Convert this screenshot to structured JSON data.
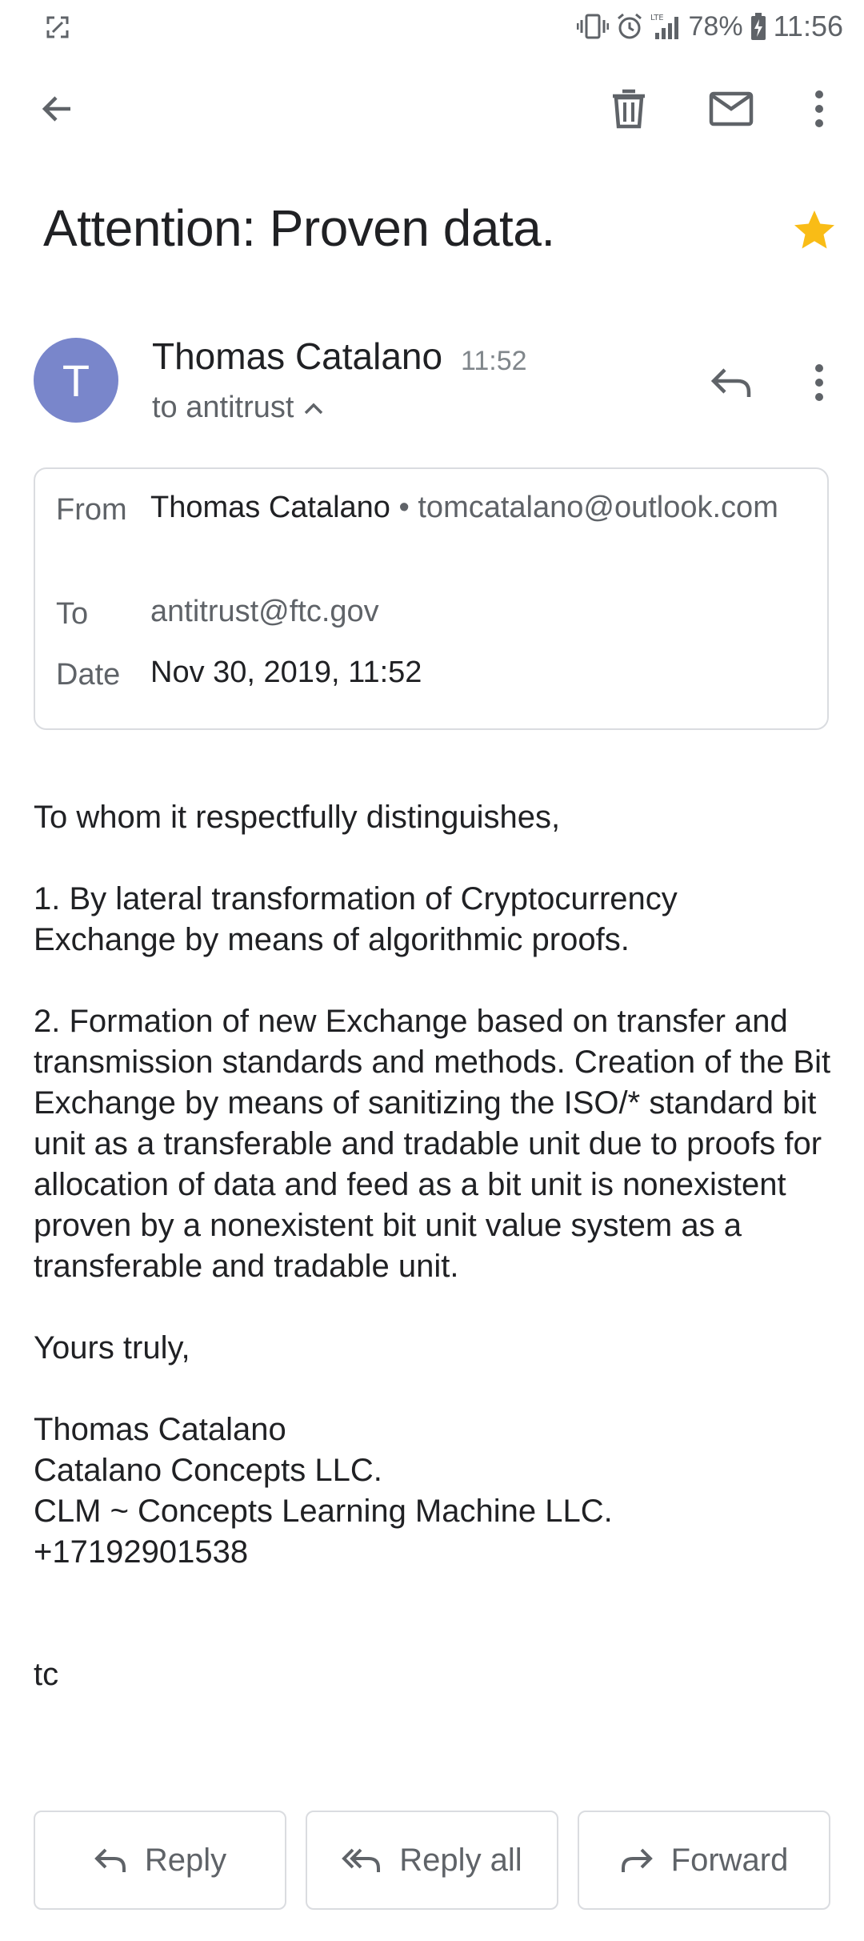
{
  "status_bar": {
    "battery": "78%",
    "time": "11:56",
    "network_label": "LTE"
  },
  "toolbar": {
    "back_icon": "arrow-back-icon",
    "delete_icon": "trash-icon",
    "mark_unread_icon": "mail-icon",
    "more_icon": "more-vert-icon"
  },
  "subject": "Attention: Proven data.",
  "starred": true,
  "colors": {
    "star": "#F9BC16",
    "avatar_bg": "#7986CB",
    "card_border": "#DADCE0"
  },
  "message": {
    "avatar_letter": "T",
    "sender_name": "Thomas Catalano",
    "time": "11:52",
    "recipient_summary": "to antitrust",
    "details": {
      "from_label": "From",
      "from_name": "Thomas Catalano",
      "separator": "•",
      "from_email": "tomcatalano@outlook.com",
      "to_label": "To",
      "to_value": "antitrust@ftc.gov",
      "date_label": "Date",
      "date_value": "Nov 30, 2019, 11:52"
    },
    "body": {
      "greeting": "To whom it respectfully distinguishes,",
      "point1": "1. By lateral transformation of Cryptocurrency Exchange by means of algorithmic proofs.",
      "point2": "2. Formation of new Exchange based on transfer and transmission standards and methods. Creation of the Bit Exchange by means of sanitizing the ISO/* standard bit unit as a transferable and tradable unit due to proofs for allocation of data and feed as a bit unit is nonexistent proven by a nonexistent bit unit value system as a transferable and tradable unit.",
      "closing": "Yours truly,",
      "signature_name": "Thomas Catalano",
      "signature_company1": "Catalano Concepts LLC.",
      "signature_company2": "CLM ~ Concepts Learning Machine LLC.",
      "signature_phone": "+17192901538",
      "initials": "tc"
    }
  },
  "actions": {
    "reply_label": "Reply",
    "reply_all_label": "Reply all",
    "forward_label": "Forward"
  }
}
